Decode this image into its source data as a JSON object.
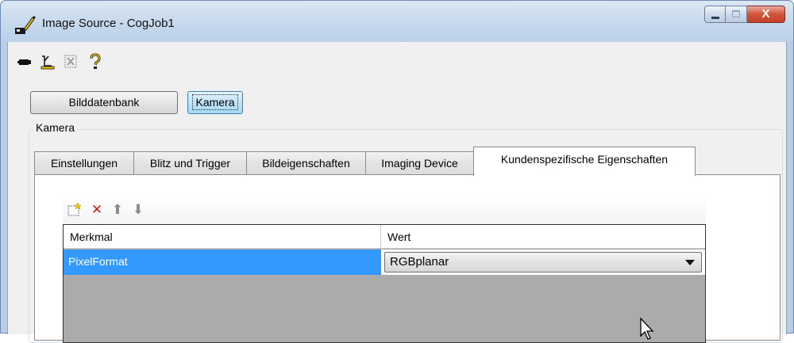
{
  "window": {
    "title": "Image Source - CogJob1",
    "icon": "image-source-app-icon",
    "caption_buttons": [
      "minimize-icon",
      "maximize-icon",
      "close-icon"
    ],
    "close_glyph": "X"
  },
  "toolbar": {
    "icons": [
      "camera-icon",
      "edit-measure-icon",
      "region-select-icon",
      "help-question-icon"
    ]
  },
  "source_buttons": {
    "database_label": "Bilddatenbank",
    "camera_label": "Kamera",
    "selected": "Kamera"
  },
  "group": {
    "label": "Kamera"
  },
  "tabs": [
    {
      "label": "Einstellungen"
    },
    {
      "label": "Blitz und Trigger"
    },
    {
      "label": "Bildeigenschaften"
    },
    {
      "label": "Imaging Device"
    },
    {
      "label": "Kundenspezifische Eigenschaften"
    }
  ],
  "selected_tab": "Kundenspezifische Eigenschaften",
  "grid_toolbar": {
    "icons": [
      "new-row-icon",
      "delete-icon",
      "move-up-icon",
      "move-down-icon"
    ],
    "delete_glyph": "✕",
    "up_glyph": "⬆",
    "down_glyph": "⬇"
  },
  "grid": {
    "columns": [
      "Merkmal",
      "Wert"
    ],
    "rows": [
      {
        "merkmal": "PixelFormat",
        "wert": "RGBplanar"
      }
    ]
  },
  "colors": {
    "selection": "#3399ff",
    "grid_empty": "#ababab",
    "active_button": "#bfe2f6",
    "close_button": "#d1543a"
  }
}
